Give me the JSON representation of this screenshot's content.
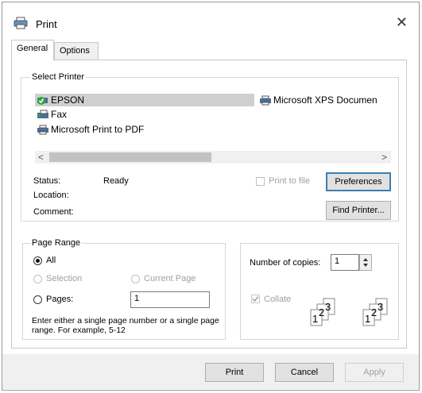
{
  "window": {
    "title": "Print",
    "close_glyph": "✕"
  },
  "tabs": [
    {
      "label": "General",
      "active": true
    },
    {
      "label": "Options",
      "active": false
    }
  ],
  "select_printer": {
    "legend": "Select Printer",
    "printers": [
      {
        "name": "EPSON",
        "selected": true,
        "icon": "printer-default-icon"
      },
      {
        "name": "Microsoft XPS Documen",
        "selected": false,
        "icon": "printer-icon"
      },
      {
        "name": "Fax",
        "selected": false,
        "icon": "fax-icon"
      },
      {
        "name": "Microsoft Print to PDF",
        "selected": false,
        "icon": "printer-icon"
      }
    ],
    "scroll_left": "<",
    "scroll_right": ">",
    "status_label": "Status:",
    "status_value": "Ready",
    "location_label": "Location:",
    "location_value": "",
    "comment_label": "Comment:",
    "comment_value": "",
    "print_to_file_label": "Print to file",
    "preferences_button": "Preferences",
    "find_printer_button": "Find Printer..."
  },
  "page_range": {
    "legend": "Page Range",
    "all_label": "All",
    "selection_label": "Selection",
    "current_page_label": "Current Page",
    "pages_label": "Pages:",
    "pages_value": "1",
    "hint": "Enter either a single page number or a single page range.  For example, 5-12"
  },
  "copies": {
    "number_label": "Number of copies:",
    "number_value": "1",
    "collate_label": "Collate",
    "collate_checked": true
  },
  "footer": {
    "print_button": "Print",
    "cancel_button": "Cancel",
    "apply_button": "Apply"
  }
}
